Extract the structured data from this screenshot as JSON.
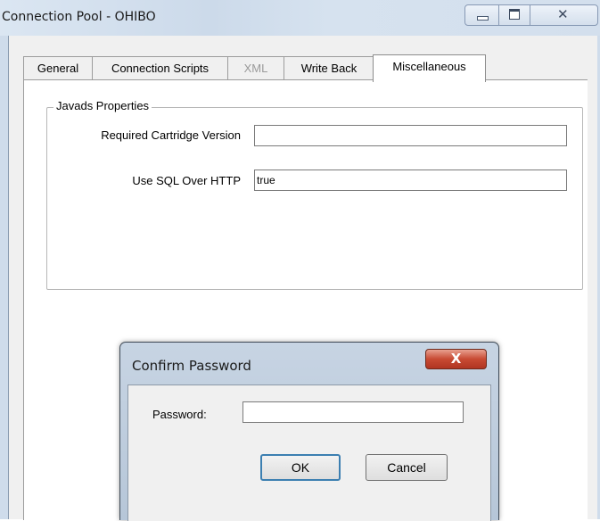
{
  "window": {
    "title": "Connection Pool - OHIBO",
    "close_glyph": "✕"
  },
  "tabs": [
    {
      "label": "General",
      "active": false,
      "disabled": false
    },
    {
      "label": "Connection Scripts",
      "active": false,
      "disabled": false
    },
    {
      "label": "XML",
      "active": false,
      "disabled": true
    },
    {
      "label": "Write Back",
      "active": false,
      "disabled": false
    },
    {
      "label": "Miscellaneous",
      "active": true,
      "disabled": false
    }
  ],
  "group": {
    "title": "Javads Properties",
    "fields": [
      {
        "label": "Required Cartridge Version",
        "value": ""
      },
      {
        "label": "Use SQL Over HTTP",
        "value": "true"
      }
    ]
  },
  "dialog": {
    "title": "Confirm Password",
    "close_glyph": "X",
    "password_label": "Password:",
    "password_value": "",
    "ok_label": "OK",
    "cancel_label": "Cancel"
  },
  "icons": [
    "minimize-icon",
    "maximize-icon",
    "close-icon"
  ],
  "colors": {
    "title_bar": "#cfdceb",
    "dialog_close": "#c84a33",
    "default_button_border": "#3c7fb1"
  }
}
